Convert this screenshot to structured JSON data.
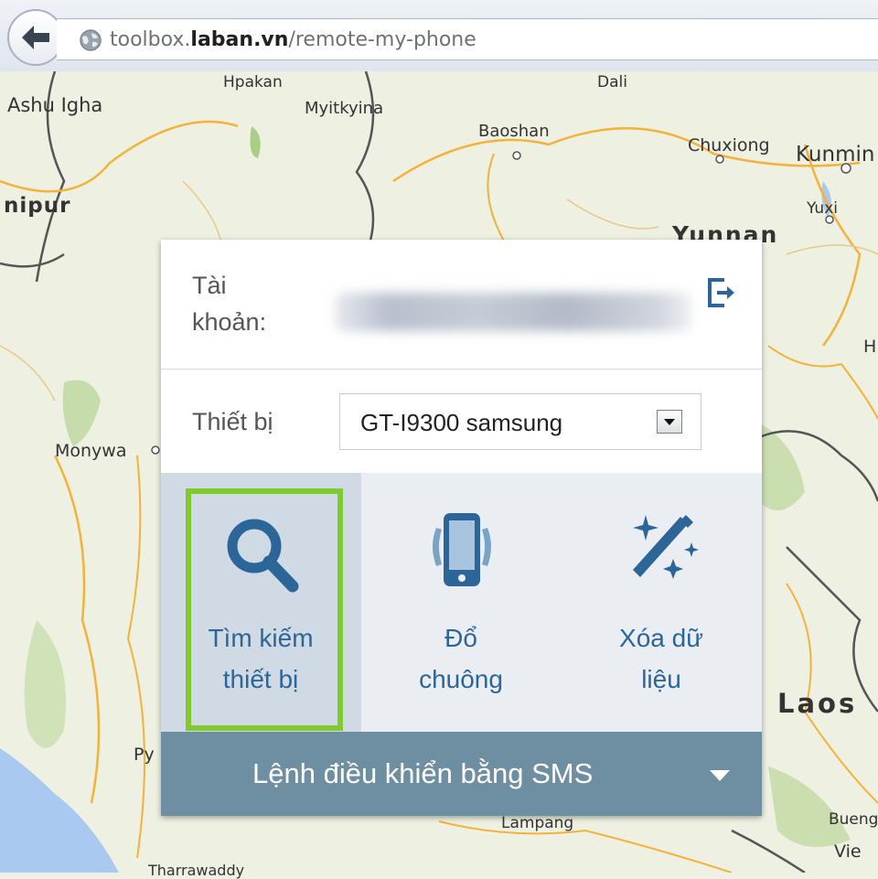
{
  "browser": {
    "url_prefix": "toolbox.",
    "url_domain": "laban.vn",
    "url_path": "/remote-my-phone"
  },
  "map": {
    "labels": [
      "Ashu Igha",
      "Hpakan",
      "Myitkyina",
      "Dali",
      "Baoshan",
      "Chuxiong",
      "Kunmin",
      "nipur",
      "Yuxi",
      "Yunnan",
      "H",
      "Monywa",
      "Laos",
      "Py",
      "Lampang",
      "Bueng",
      "Vie",
      "Tharrawaddy"
    ]
  },
  "panel": {
    "account_label": "Tài khoản:",
    "device_label": "Thiết bị",
    "device_value": "GT-I9300 samsung",
    "actions": [
      {
        "label": "Tìm kiếm thiết bị",
        "icon": "search-icon",
        "active": true
      },
      {
        "label": "Đổ chuông",
        "icon": "phone-ring-icon",
        "active": false
      },
      {
        "label": "Xóa dữ liệu",
        "icon": "magic-wand-icon",
        "active": false
      }
    ],
    "sms_label": "Lệnh điều khiển bằng SMS"
  },
  "colors": {
    "accent": "#2c6699",
    "sms_bar": "#6e8fa1",
    "highlight": "#7fcb2f"
  }
}
